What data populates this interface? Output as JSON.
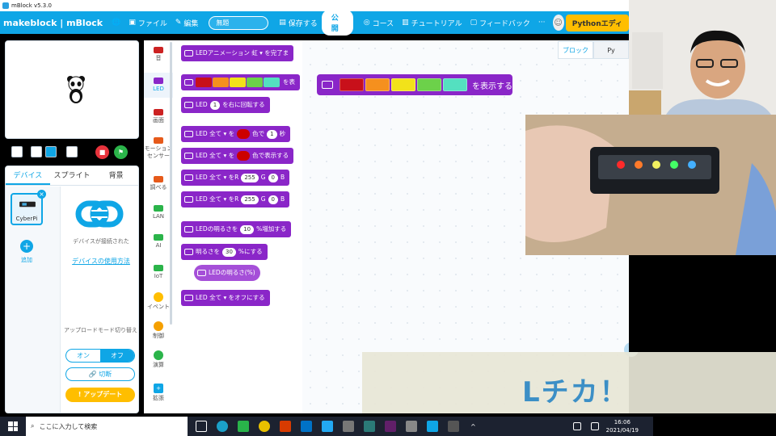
{
  "window": {
    "title": "mBlock v5.3.0"
  },
  "menubar": {
    "logo": "makeblock | mBlock",
    "file": "ファイル",
    "edit": "編集",
    "project_name": "無題",
    "save": "保存する",
    "publish": "公 開",
    "courses": "コース",
    "tutorials": "チュートリアル",
    "feedback": "フィードバック",
    "more": "···",
    "python_editor": "Pythonエディ"
  },
  "left": {
    "tabs": [
      "デバイス",
      "スプライト",
      "背景"
    ],
    "device_name": "CyberPi",
    "add": "追加",
    "connected": "デバイスが接続された",
    "howto": "デバイスの使用方法",
    "upload_mode": "アップロードモード切り替え",
    "on": "オン",
    "off": "オフ",
    "disconnect": "切断",
    "update": "アップデート"
  },
  "categories": [
    {
      "label": "音",
      "color": "#c22"
    },
    {
      "label": "LED",
      "color": "#8a26c8"
    },
    {
      "label": "画面",
      "color": "#c22"
    },
    {
      "label": "モーションセンサー",
      "color": "#e65a1a"
    },
    {
      "label": "調べる",
      "color": "#e65a1a"
    },
    {
      "label": "LAN",
      "color": "#2bb44a"
    },
    {
      "label": "AI",
      "color": "#2bb44a"
    },
    {
      "label": "IoT",
      "color": "#2bb44a"
    },
    {
      "label": "イベント",
      "color": "#ffbe00"
    },
    {
      "label": "制御",
      "color": "#f5a000"
    },
    {
      "label": "演算",
      "color": "#2bb44a"
    },
    {
      "label": "拡張",
      "color": "#0fa6e6"
    }
  ],
  "blocks": {
    "b1": "LEDアニメーション  虹 ▾  を完了ま",
    "b2_tail": "を表",
    "b3_a": "LED",
    "b3_n": "1",
    "b3_b": "を右に回転する",
    "b4_a": "LED  全て ▾  を",
    "b4_b": "色で",
    "b4_n": "1",
    "b4_c": "秒",
    "b5_a": "LED  全て ▾  を",
    "b5_b": "色で表示する",
    "b6_a": "LED  全て ▾  をR",
    "b6_n1": "255",
    "b6_g": "G",
    "b6_n2": "0",
    "b6_b": "B",
    "b7_a": "LED  全て ▾  をR",
    "b7_n1": "255",
    "b7_g": "G",
    "b7_n2": "0",
    "b7_b": "B",
    "b8_a": "LEDの明るさを",
    "b8_n": "10",
    "b8_b": "%増加する",
    "b9_a": "明るさを",
    "b9_n": "30",
    "b9_b": "%にする",
    "b10": "LEDの明るさ(%)",
    "b11": "LED  全て ▾  をオフにする"
  },
  "workspace": {
    "block_label": "を表示する",
    "right_tabs": [
      "ブロック",
      "Py"
    ]
  },
  "led_colors": [
    "#c8101a",
    "#f5901e",
    "#f2e21a",
    "#6cd14a",
    "#54e0c0"
  ],
  "caption": "Lチカ！",
  "taskbar": {
    "search": "ここに入力して検索",
    "time": "16:06",
    "date": "2021/04/19"
  }
}
